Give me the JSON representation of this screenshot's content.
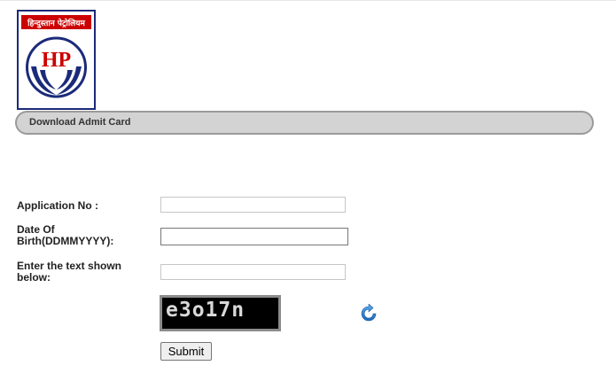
{
  "header": {
    "title": "Download Admit Card"
  },
  "logo": {
    "hindi_text": "हिन्दुस्तान पेट्रोलियम",
    "letters": "HP",
    "colors": {
      "red": "#cc0000",
      "navy": "#1b2a7a"
    }
  },
  "form": {
    "application_no_label": "Application No :",
    "application_no_value": "",
    "dob_label_line1": "Date Of",
    "dob_label_line2": "Birth(DDMMYYYY):",
    "dob_value": "",
    "captcha_label_line1": "Enter the text shown",
    "captcha_label_line2": "below:",
    "captcha_value": "",
    "captcha_text": "e3o17n",
    "refresh_icon": "refresh-icon",
    "submit_label": "Submit"
  }
}
